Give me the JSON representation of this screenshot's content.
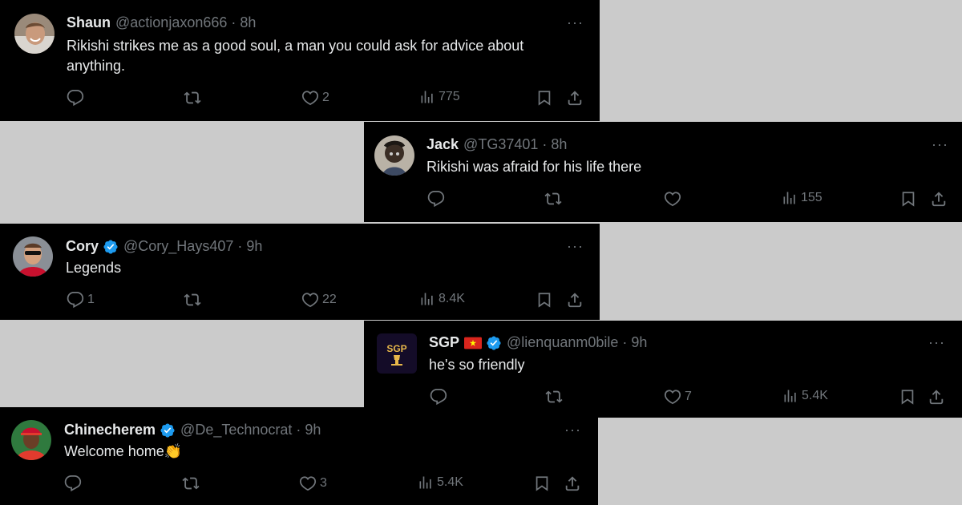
{
  "colors": {
    "background": "#cbcbcb",
    "card": "#000000",
    "text": "#e7e9ea",
    "muted": "#71767b",
    "verified": "#1d9bf0"
  },
  "icons": [
    "reply-icon",
    "retweet-icon",
    "like-icon",
    "views-icon",
    "bookmark-icon",
    "share-icon",
    "more-icon",
    "verified-badge-icon",
    "vietnam-flag-icon"
  ],
  "tweets": [
    {
      "name": "Shaun",
      "handle": "@actionjaxon666",
      "dot": "·",
      "time": "8h",
      "more": "···",
      "text_lines": [
        "Rikishi strikes me as a good soul, a man you could ask for advice about",
        "anything."
      ],
      "replies": "",
      "reposts": "",
      "likes": "2",
      "views": "775"
    },
    {
      "name": "Jack",
      "handle": "@TG37401",
      "dot": "·",
      "time": "8h",
      "more": "···",
      "text_lines": [
        "Rikishi was afraid for his life there"
      ],
      "replies": "",
      "reposts": "",
      "likes": "",
      "views": "155"
    },
    {
      "name": "Cory",
      "verified": true,
      "handle": "@Cory_Hays407",
      "dot": "·",
      "time": "9h",
      "more": "···",
      "text_lines": [
        "Legends"
      ],
      "replies": "1",
      "reposts": "",
      "likes": "22",
      "views": "8.4K"
    },
    {
      "name": "SGP",
      "flag": "vietnam",
      "verified": true,
      "handle": "@lienquanm0bile",
      "dot": "·",
      "time": "9h",
      "more": "···",
      "text_lines": [
        "he's so friendly"
      ],
      "avatar_text": "SGP",
      "replies": "",
      "reposts": "",
      "likes": "7",
      "views": "5.4K"
    },
    {
      "name": "Chinecherem",
      "verified": true,
      "handle": "@De_Technocrat",
      "dot": "·",
      "time": "9h",
      "more": "···",
      "text_lines": [
        "Welcome home👏"
      ],
      "replies": "",
      "reposts": "",
      "likes": "3",
      "views": "5.4K"
    }
  ]
}
